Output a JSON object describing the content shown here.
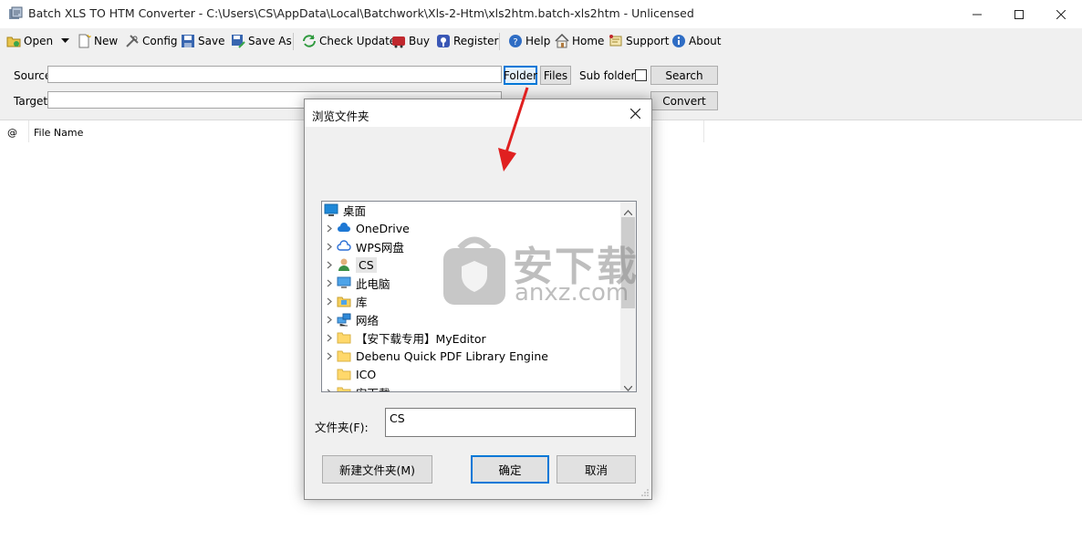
{
  "window": {
    "title": "Batch XLS TO HTM Converter - C:\\Users\\CS\\AppData\\Local\\Batchwork\\Xls-2-Htm\\xls2htm.batch-xls2htm - Unlicensed"
  },
  "toolbar": {
    "open": "Open",
    "new": "New",
    "config": "Config",
    "save": "Save",
    "save_as": "Save As",
    "check_update": "Check Update",
    "buy": "Buy",
    "register": "Register",
    "help": "Help",
    "home": "Home",
    "support": "Support",
    "about": "About"
  },
  "panel": {
    "source_label": "Source",
    "target_label": "Target",
    "source_value": "",
    "target_value": "",
    "folder_button": "Folder",
    "files_button": "Files",
    "subfolders_label": "Sub folders",
    "subfolders_checked": false,
    "search_button": "Search",
    "convert_button": "Convert"
  },
  "list": {
    "columns": [
      "@",
      "File Name"
    ]
  },
  "dialog": {
    "title": "浏览文件夹",
    "tree": [
      {
        "label": "桌面",
        "icon": "desktop-icon",
        "expandable": false
      },
      {
        "label": "OneDrive",
        "icon": "cloud-icon",
        "expandable": true
      },
      {
        "label": "WPS网盘",
        "icon": "cloud-outline-icon",
        "expandable": true
      },
      {
        "label": "CS",
        "icon": "user-icon",
        "expandable": true
      },
      {
        "label": "此电脑",
        "icon": "computer-icon",
        "expandable": true
      },
      {
        "label": "库",
        "icon": "library-icon",
        "expandable": true
      },
      {
        "label": "网络",
        "icon": "network-icon",
        "expandable": true
      },
      {
        "label": "【安下载专用】MyEditor",
        "icon": "folder-icon",
        "expandable": true
      },
      {
        "label": "Debenu Quick PDF Library Engine",
        "icon": "folder-icon",
        "expandable": true
      },
      {
        "label": "ICO",
        "icon": "folder-icon",
        "expandable": false
      },
      {
        "label": "安下载",
        "icon": "folder-icon",
        "expandable": true
      }
    ],
    "folder_label": "文件夹(F):",
    "folder_value": "CS",
    "new_folder_button": "新建文件夹(M)",
    "ok_button": "确定",
    "cancel_button": "取消"
  },
  "watermark": {
    "text_cn": "安下载",
    "text_en": "anxz.com"
  },
  "colors": {
    "arrow": "#e02020",
    "selected_border": "#0078d7",
    "toolbar_bg": "#f0f0f0"
  }
}
